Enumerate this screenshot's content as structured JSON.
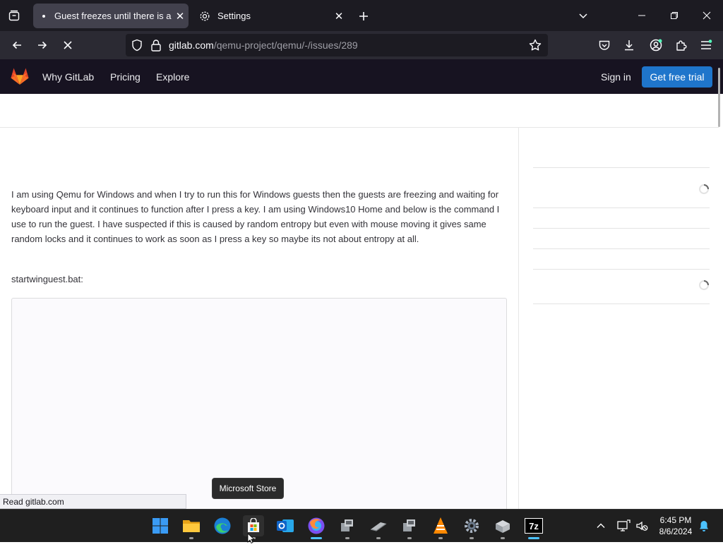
{
  "browser": {
    "tabs": [
      {
        "title": "Guest freezes until there is a key",
        "active": true,
        "loading": true
      },
      {
        "title": "Settings",
        "active": false,
        "icon": "gear-icon"
      }
    ],
    "url_host": "gitlab.com",
    "url_path": "/qemu-project/qemu/-/issues/289",
    "status_text": "Read gitlab.com"
  },
  "gitlab": {
    "nav": [
      "Why GitLab",
      "Pricing",
      "Explore"
    ],
    "sign_in": "Sign in",
    "trial": "Get free trial"
  },
  "issue": {
    "description": "I am using Qemu for Windows and when I try to run this for Windows guests then the guests are freezing and waiting for keyboard input and it continues to function after I press a key. I am using Windows10 Home and below is the command I use to run the guest. I have suspected if this is caused by random entropy but even with mouse moving it gives same random locks and it continues to work as soon as I press a key so maybe its not about entropy at all.",
    "file_label": "startwinguest.bat:"
  },
  "tooltip": "Microsoft Store",
  "taskbar": {
    "apps": [
      "start",
      "file-explorer",
      "edge",
      "microsoft-store",
      "outlook",
      "firefox",
      "app-1",
      "app-2",
      "app-3",
      "vlc",
      "settings",
      "app-4",
      "7zip"
    ],
    "time": "6:45 PM",
    "date": "8/6/2024"
  },
  "colors": {
    "gitlab_header": "#171321",
    "trial_button": "#1f75cb",
    "browser_titlebar": "#1c1b22",
    "browser_toolbar": "#2b2a33"
  }
}
